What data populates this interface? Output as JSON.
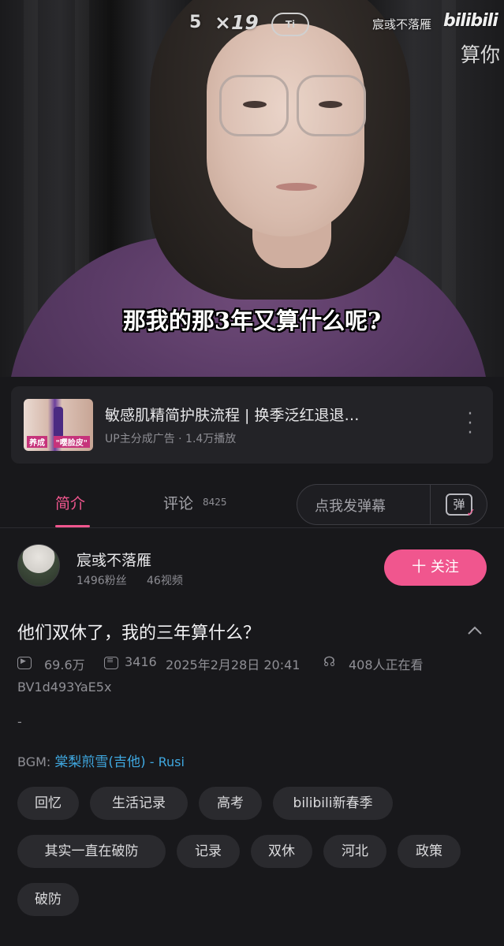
{
  "video": {
    "overlay_number": "5",
    "overlay_multiplier": "×19",
    "overlay_badge": "Ti",
    "overlay_author": "宸彧不落雁",
    "overlay_logo": "bilibili",
    "overlay_side_text": "算你",
    "subtitle": "那我的那3年又算什么呢?"
  },
  "ad": {
    "thumb_tag_left": "养成",
    "thumb_tag_right": "\"嘤脸皮\"",
    "title": "敏感肌精简护肤流程 | 换季泛红退退…",
    "meta": "UP主分成广告 · 1.4万播放"
  },
  "tabs": {
    "intro": "简介",
    "comments": "评论",
    "comments_count": "8425",
    "danmaku_placeholder": "点我发弹幕",
    "danmaku_icon": "弹"
  },
  "uploader": {
    "name": "宸彧不落雁",
    "fans": "1496粉丝",
    "videos": "46视频",
    "follow_label": "十 关注"
  },
  "video_info": {
    "title": "他们双休了，我的三年算什么？",
    "views": "69.6万",
    "danmaku_count": "3416",
    "date": "2025年2月28日 20:41",
    "watching": "408人正在看",
    "bvid": "BV1d493YaE5x",
    "description": "-",
    "bgm_label": "BGM:",
    "bgm_song": "棠梨煎雪(吉他)",
    "bgm_artist": " - Rusi"
  },
  "tags": [
    "回忆",
    "生活记录",
    "高考",
    "bilibili新春季",
    "其实一直在破防",
    "记录",
    "双休",
    "河北",
    "政策",
    "破防"
  ],
  "colors": {
    "accent": "#f0568e",
    "link": "#3fa8e0",
    "background": "#18181b"
  }
}
